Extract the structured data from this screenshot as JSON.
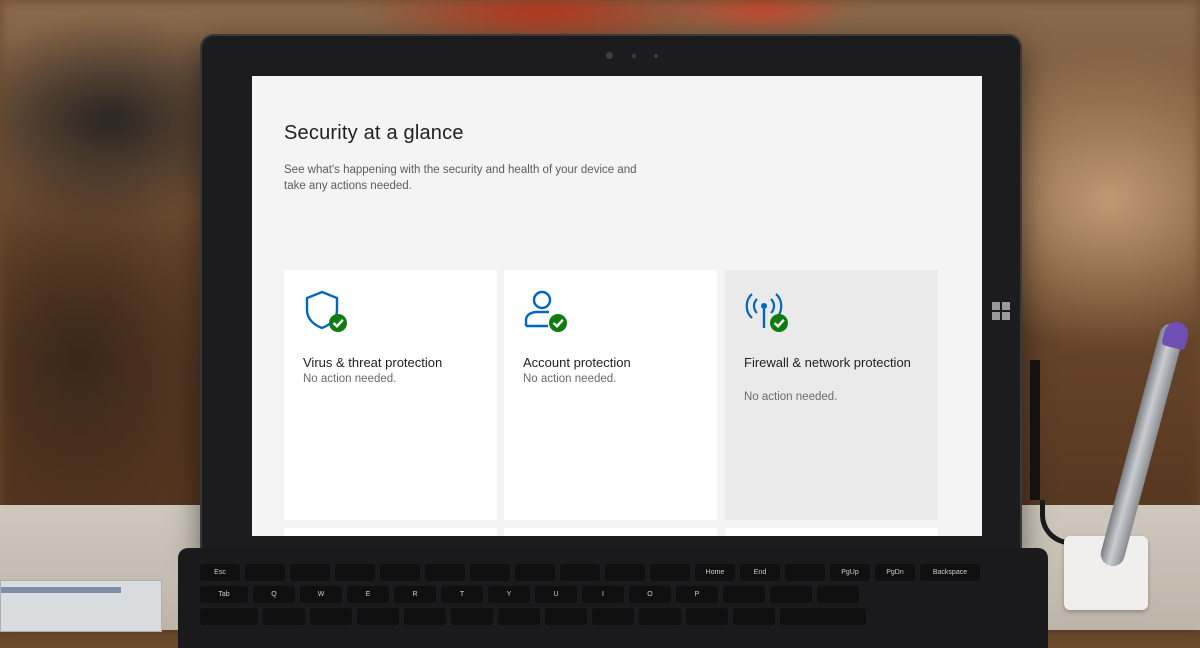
{
  "screen": {
    "title": "Security at a glance",
    "subtitle": "See what's happening with the security and health of your device and take any actions needed."
  },
  "tiles": [
    {
      "name": "Virus & threat protection",
      "status": "No action needed.",
      "icon": "shield-check-icon"
    },
    {
      "name": "Account protection",
      "status": "No action needed.",
      "icon": "person-check-icon"
    },
    {
      "name": "Firewall & network protection",
      "status": "No action needed.",
      "icon": "network-antenna-check-icon"
    }
  ],
  "lower_tiles": [
    {
      "icon": "app-browser-control-icon"
    },
    {
      "icon": "device-security-icon"
    },
    {
      "icon": "heart-health-icon"
    }
  ],
  "keyboard": {
    "row1": [
      "Esc",
      "",
      "",
      "",
      "",
      "",
      "",
      "",
      "",
      "",
      "",
      "Home",
      "End",
      "",
      "PgUp",
      "PgDn",
      "Backspace"
    ],
    "row2": [
      "Tab",
      "Q",
      "W",
      "E",
      "R",
      "T",
      "Y",
      "U",
      "I",
      "O",
      "P",
      "",
      "",
      ""
    ]
  },
  "colors": {
    "accent": "#0067c0",
    "ok": "#107c10",
    "screen_bg": "#f4f4f4",
    "tile_bg": "#ffffff",
    "tile_selected_bg": "#eaeaea"
  }
}
